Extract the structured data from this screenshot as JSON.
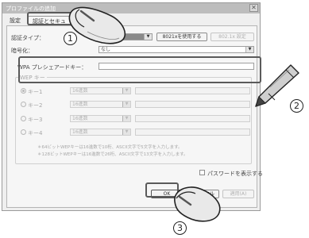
{
  "window": {
    "title": "プロファイルの追加",
    "close_glyph": "✕"
  },
  "tabs": [
    {
      "label": "設定"
    },
    {
      "label": "認証とセキュリティ"
    }
  ],
  "auth_type": {
    "label": "認証タイプ：",
    "value": "",
    "use_8021x_label": "8021xを使用する",
    "settings_8021x_label": "802.1x 設定"
  },
  "encryption": {
    "label": "暗号化：",
    "value": "なし"
  },
  "wpa": {
    "label": "WPA プレシェアードキー："
  },
  "wep": {
    "group_label": "WEP キー",
    "keys": [
      {
        "label": "キー1",
        "format": "16進数"
      },
      {
        "label": "キー2",
        "format": "16進数"
      },
      {
        "label": "キー3",
        "format": "16進数"
      },
      {
        "label": "キー4",
        "format": "16進数"
      }
    ],
    "note_line1": "＊64ビットWEPキーは16進数で10桁、ASCII文字で5文字を入力します。",
    "note_line2": "＊128ビットWEPキーは16進数で26桁、ASCII文字で13文字を入力します。"
  },
  "show_password": {
    "label": "パスワードを表示する",
    "checked": false
  },
  "buttons": {
    "ok": "OK",
    "cancel": "キャンセル",
    "apply": "適用(A)"
  },
  "callouts": {
    "one": "1",
    "two": "2",
    "three": "3"
  },
  "icons": {
    "mouse": "mouse-icon",
    "pencil": "pencil-icon"
  }
}
